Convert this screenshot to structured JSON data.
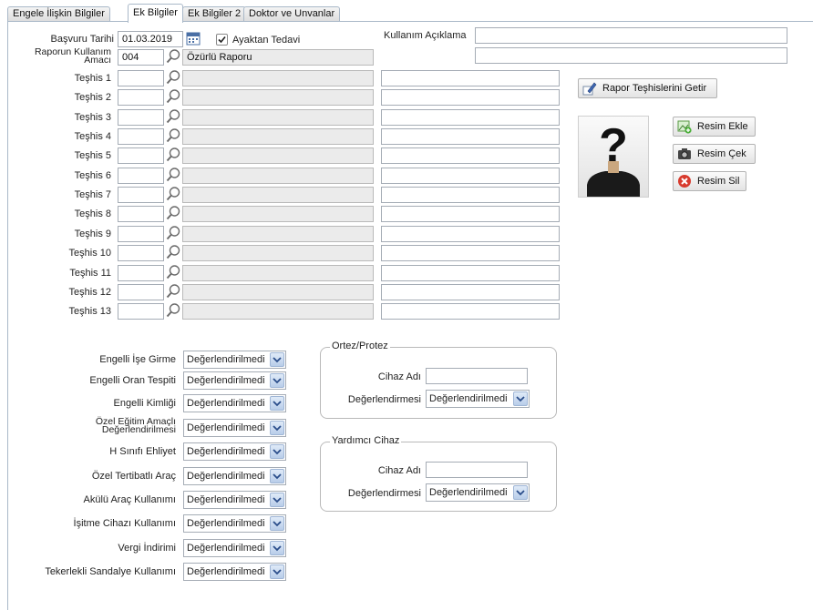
{
  "tabs": [
    {
      "label": "Engele İlişkin Bilgiler"
    },
    {
      "label": "Ek Bilgiler"
    },
    {
      "label": "Ek Bilgiler 2"
    },
    {
      "label": "Doktor ve Unvanlar"
    }
  ],
  "basvuru": {
    "label": "Başvuru Tarihi",
    "value": "01.03.2019"
  },
  "ayaktan": {
    "label": "Ayaktan Tedavi",
    "checked": true
  },
  "kullanim_aciklama": {
    "label": "Kullanım Açıklama",
    "value": "",
    "value2": ""
  },
  "rapor_kullanim": {
    "label_line1": "Raporun Kullanım",
    "label_line2": "Amacı",
    "code": "004",
    "name": "Özürlü Raporu"
  },
  "teshisler": [
    {
      "label": "Teşhis 1"
    },
    {
      "label": "Teşhis 2"
    },
    {
      "label": "Teşhis 3"
    },
    {
      "label": "Teşhis 4"
    },
    {
      "label": "Teşhis 5"
    },
    {
      "label": "Teşhis 6"
    },
    {
      "label": "Teşhis 7"
    },
    {
      "label": "Teşhis 8"
    },
    {
      "label": "Teşhis 9"
    },
    {
      "label": "Teşhis 10"
    },
    {
      "label": "Teşhis 11"
    },
    {
      "label": "Teşhis 12"
    },
    {
      "label": "Teşhis 13"
    }
  ],
  "buttons": {
    "rapor_teshis": "Rapor Teşhislerini Getir",
    "resim_ekle": "Resim Ekle",
    "resim_cek": "Resim Çek",
    "resim_sil": "Resim Sil"
  },
  "dropdowns": [
    {
      "label": "Engelli İşe Girme",
      "value": "Değerlendirilmedi"
    },
    {
      "label": "Engelli Oran Tespiti",
      "value": "Değerlendirilmedi"
    },
    {
      "label": "Engelli Kimliği",
      "value": "Değerlendirilmedi"
    },
    {
      "label_line1": "Özel Eğitim Amaçlı",
      "label_line2": "Değerlendirilmesi",
      "value": "Değerlendirilmedi"
    },
    {
      "label": "H Sınıfı Ehliyet",
      "value": "Değerlendirilmedi"
    },
    {
      "label": "Özel Tertibatlı Araç",
      "value": "Değerlendirilmedi"
    },
    {
      "label": "Akülü Araç Kullanımı",
      "value": "Değerlendirilmedi"
    },
    {
      "label": "İşitme Cihazı Kullanımı",
      "value": "Değerlendirilmedi"
    },
    {
      "label": "Vergi İndirimi",
      "value": "Değerlendirilmedi"
    },
    {
      "label": "Tekerlekli Sandalye Kullanımı",
      "value": "Değerlendirilmedi"
    }
  ],
  "ortez": {
    "legend": "Ortez/Protez",
    "cihaz_label": "Cihaz Adı",
    "cihaz_value": "",
    "degerlendirme_label": "Değerlendirmesi",
    "degerlendirme_value": "Değerlendirilmedi"
  },
  "yardimci": {
    "legend": "Yardımcı Cihaz",
    "cihaz_label": "Cihaz Adı",
    "cihaz_value": "",
    "degerlendirme_label": "Değerlendirmesi",
    "degerlendirme_value": "Değerlendirilmedi"
  },
  "colors": {
    "accent": "#4a6fa5",
    "tab_border": "#a9b8c8",
    "readonly_bg": "#ebebeb",
    "select_arrow": "#b8cde9"
  },
  "icons": {
    "calendar": "calendar-icon",
    "magnifier": "magnifier-icon",
    "checkbox": "check-icon",
    "pencil": "pencil-icon",
    "add_image": "add-image-icon",
    "camera": "camera-icon",
    "delete": "delete-icon",
    "avatar": "avatar-placeholder-icon"
  }
}
